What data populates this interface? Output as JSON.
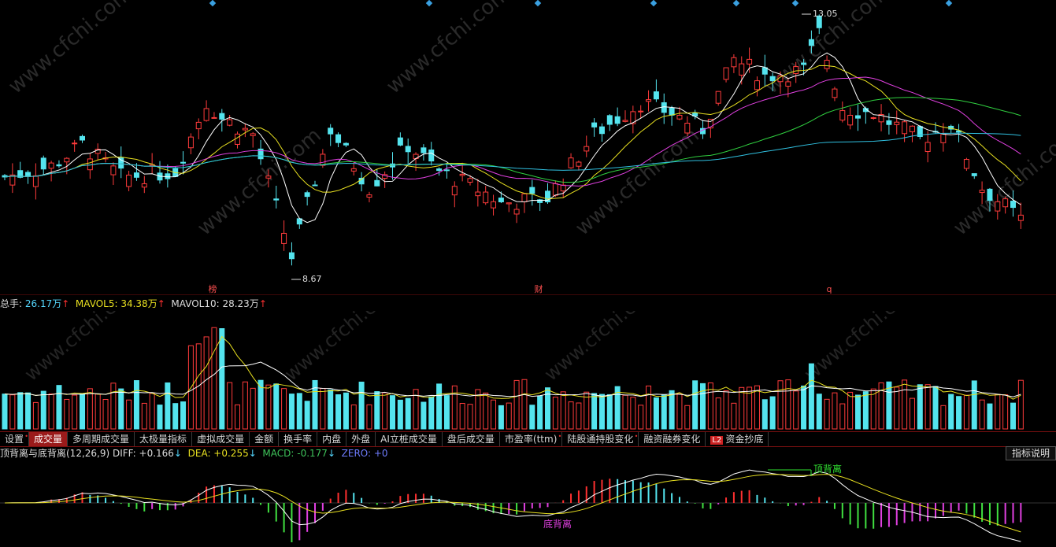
{
  "chart_data": [
    {
      "type": "candlestick",
      "panel": "price",
      "x_count": 132,
      "annotations": {
        "high_label": "13.05",
        "low_label": "8.67"
      },
      "event_markers": [
        "榜",
        "财",
        "q"
      ],
      "ma_colors": [
        "#ffffff",
        "#e8e020",
        "#e040e0",
        "#30d040",
        "#30c0e0"
      ],
      "ylim": [
        8.2,
        13.3
      ]
    },
    {
      "type": "bar",
      "panel": "volume",
      "ma_lines": [
        "MAVOL5",
        "MAVOL10"
      ]
    },
    {
      "type": "bar",
      "panel": "macd",
      "params": "(12,26,9)",
      "annotations": [
        "顶背离",
        "底背离"
      ]
    }
  ],
  "volume_info": {
    "total": "总手: 26.17万",
    "mavol5": "MAVOL5: 34.38万",
    "mavol10": "MAVOL10: 28.23万"
  },
  "tabs": [
    {
      "label": "设置",
      "sup": "•"
    },
    {
      "label": "成交量",
      "active": true
    },
    {
      "label": "多周期成交量"
    },
    {
      "label": "太极量指标"
    },
    {
      "label": "虚拟成交量"
    },
    {
      "label": "金额"
    },
    {
      "label": "换手率"
    },
    {
      "label": "内盘"
    },
    {
      "label": "外盘"
    },
    {
      "label": "AI立桩成交量"
    },
    {
      "label": "盘后成交量"
    },
    {
      "label": "市盈率(ttm)",
      "sup": "•"
    },
    {
      "label": "陆股通持股变化",
      "sup": "•"
    },
    {
      "label": "融资融券变化"
    },
    {
      "label": "资金抄底",
      "badge": "L2"
    }
  ],
  "macd_info": {
    "title": "顶背离与底背离(12,26,9)",
    "diff": "DIFF: +0.166",
    "dea": "DEA: +0.255",
    "macd": "MACD: -0.177",
    "zero": "ZERO: +0",
    "help": "指标说明"
  },
  "arrows": {
    "up": "↑",
    "down": "↓"
  },
  "watermark": "www.cfchi.com"
}
